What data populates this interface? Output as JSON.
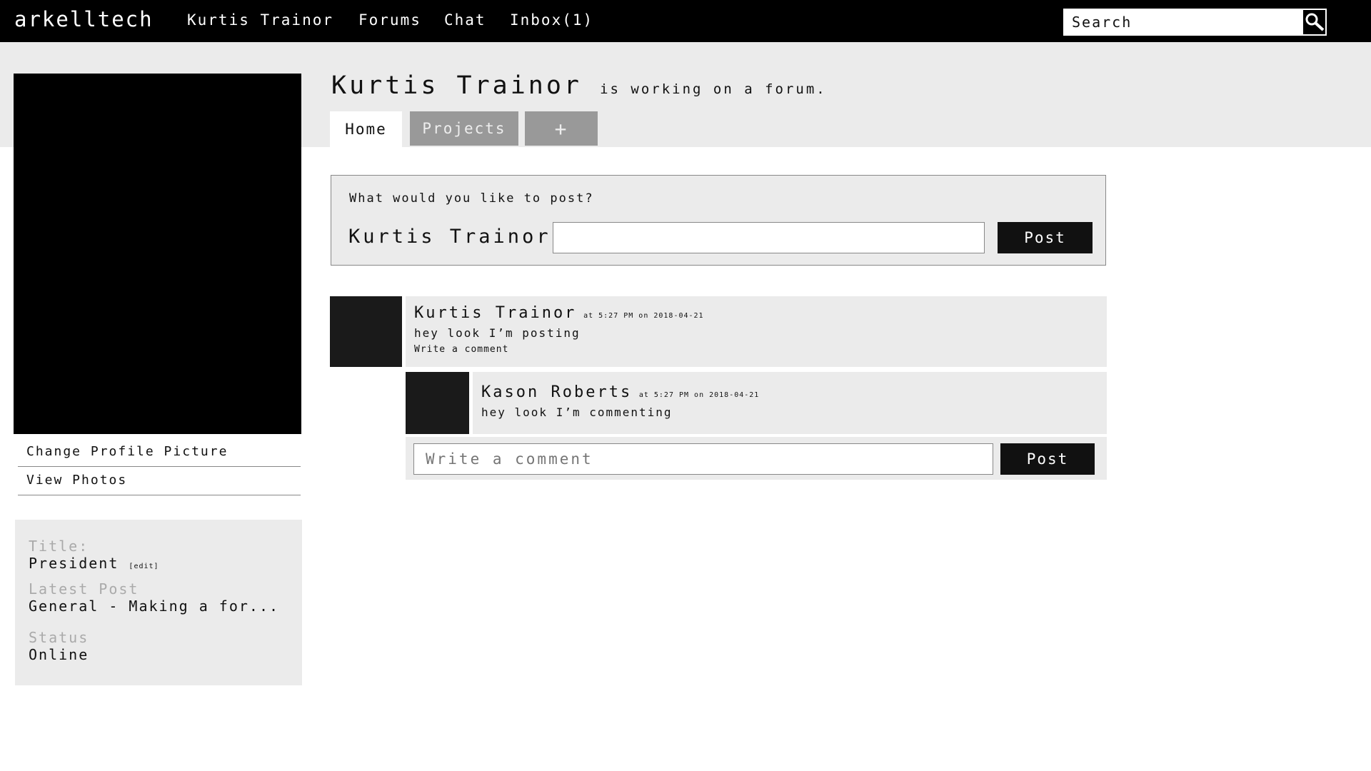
{
  "nav": {
    "logo": "arkelltech",
    "items": [
      "Kurtis Trainor",
      "Forums",
      "Chat",
      "Inbox(1)"
    ],
    "search_placeholder": "Search",
    "search_icon": "magnifier-icon"
  },
  "sidebar": {
    "links": [
      "Change Profile Picture",
      "View Photos"
    ],
    "info": {
      "title_label": "Title:",
      "title_value": "President",
      "edit": "[edit]",
      "latest_label": "Latest Post",
      "latest_value": "General - Making a for...",
      "status_label": "Status",
      "status_value": "Online"
    }
  },
  "header": {
    "name": "Kurtis Trainor",
    "status": "is working on a forum.",
    "tabs": [
      "Home",
      "Projects",
      "+"
    ],
    "active_tab": "Home"
  },
  "composer": {
    "prompt": "What would you like to post?",
    "name": "Kurtis Trainor",
    "input_value": "",
    "button": "Post"
  },
  "post": {
    "author": "Kurtis Trainor",
    "meta": "at 5:27 PM on 2018-04-21",
    "body": "hey look I’m posting",
    "comment_link": "Write a comment",
    "comments": [
      {
        "author": "Kason Roberts",
        "meta": "at 5:27 PM on 2018-04-21",
        "body": "hey look I’m commenting"
      }
    ],
    "comment_form": {
      "placeholder": "Write a comment",
      "button": "Post"
    }
  },
  "colors": {
    "topbar": "#000000",
    "panel": "#ebebeb",
    "tab_inactive": "#999999",
    "button": "#111111"
  }
}
